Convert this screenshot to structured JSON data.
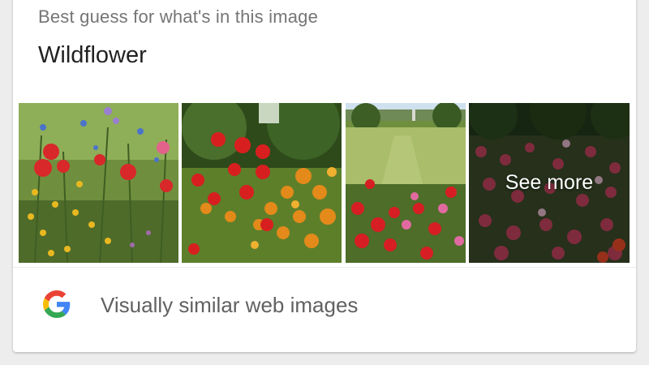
{
  "best_guess": {
    "subtitle": "Best guess for what's in this image",
    "label": "Wildflower"
  },
  "image_strip": {
    "see_more_label": "See more"
  },
  "footer": {
    "icon": "google-g-icon",
    "label": "Visually similar web images"
  },
  "colors": {
    "google_blue": "#4285F4",
    "google_red": "#EA4335",
    "google_yellow": "#FBBC05",
    "google_green": "#34A853"
  }
}
